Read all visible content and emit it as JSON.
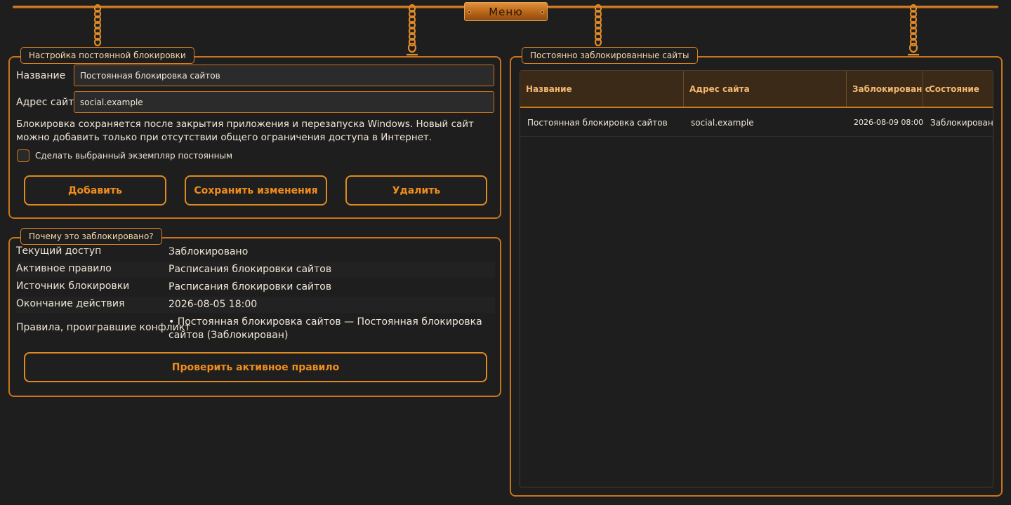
{
  "menu": {
    "label": "Меню"
  },
  "settings": {
    "legend": "Настройка постоянной блокировки",
    "name_label": "Название",
    "name_value": "Постоянная блокировка сайтов",
    "address_label": "Адрес сайта",
    "address_value": "social.example",
    "info": "Блокировка сохраняется после закрытия приложения и перезапуска Windows. Новый сайт можно добавить только при отсутствии общего ограничения доступа в Интернет.",
    "checkbox_label": "Сделать выбранный экземпляр постоянным",
    "checkbox_checked": false,
    "buttons": {
      "add": "Добавить",
      "save": "Сохранить изменения",
      "delete": "Удалить"
    }
  },
  "why": {
    "legend": "Почему это заблокировано?",
    "rows": [
      {
        "key": "Текущий доступ",
        "value": "Заблокировано"
      },
      {
        "key": "Активное правило",
        "value": "Расписания блокировки сайтов"
      },
      {
        "key": "Источник блокировки",
        "value": "Расписания блокировки сайтов"
      },
      {
        "key": "Окончание действия",
        "value": "2026-08-05 18:00"
      },
      {
        "key": "Правила, проигравшие конфликт",
        "value": "• Постоянная блокировка сайтов — Постоянная блокировка сайтов (Заблокирован)"
      }
    ],
    "check_button": "Проверить активное правило"
  },
  "sites": {
    "legend": "Постоянно заблокированные сайты",
    "columns": [
      "Название",
      "Адрес сайта",
      "Заблокирован с",
      "Состояние"
    ],
    "rows": [
      [
        "Постоянная блокировка сайтов",
        "social.example",
        "2026-08-09 08:00",
        "Заблокирован"
      ]
    ]
  },
  "colors": {
    "accent": "#e08a1e",
    "background": "#1e1e1e",
    "header_bg": "#3b2a18",
    "text": "#efe6d6"
  }
}
